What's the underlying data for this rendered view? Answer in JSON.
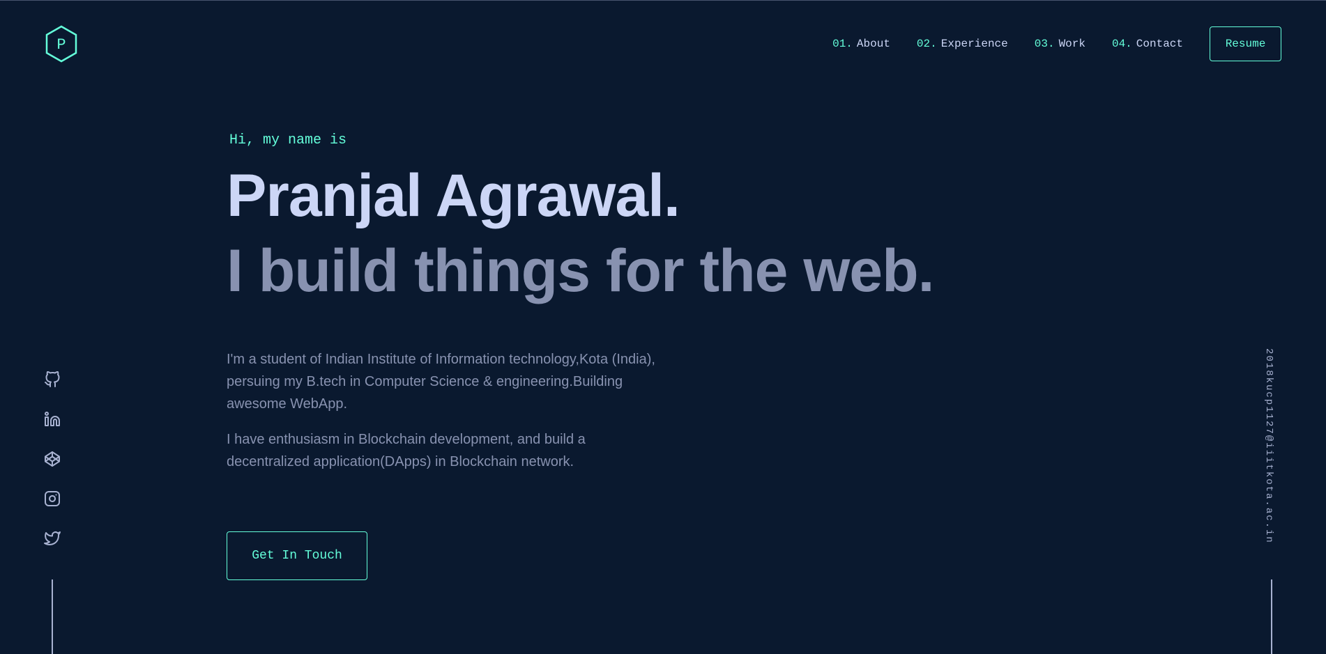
{
  "header": {
    "logo_letter": "P",
    "nav": [
      {
        "num": "01.",
        "label": "About"
      },
      {
        "num": "02.",
        "label": "Experience"
      },
      {
        "num": "03.",
        "label": "Work"
      },
      {
        "num": "04.",
        "label": "Contact"
      }
    ],
    "resume_label": "Resume"
  },
  "hero": {
    "greeting": "Hi, my name is",
    "name": "Pranjal Agrawal.",
    "tagline": "I build things for the web.",
    "bio": [
      "I'm a student of Indian Institute of Information technology,Kota (India), persuing my B.tech in Computer Science & engineering.Building awesome WebApp.",
      "I have enthusiasm in Blockchain development, and build a decentralized application(DApps) in Blockchain network."
    ],
    "cta_label": "Get In Touch"
  },
  "social": {
    "icons": [
      "github-icon",
      "linkedin-icon",
      "codepen-icon",
      "instagram-icon",
      "twitter-icon"
    ]
  },
  "email": "2018kucp1127@iiitkota.ac.in",
  "colors": {
    "background": "#0a192f",
    "accent": "#64ffda",
    "lightest_slate": "#ccd6f6",
    "slate": "#8892b0"
  }
}
